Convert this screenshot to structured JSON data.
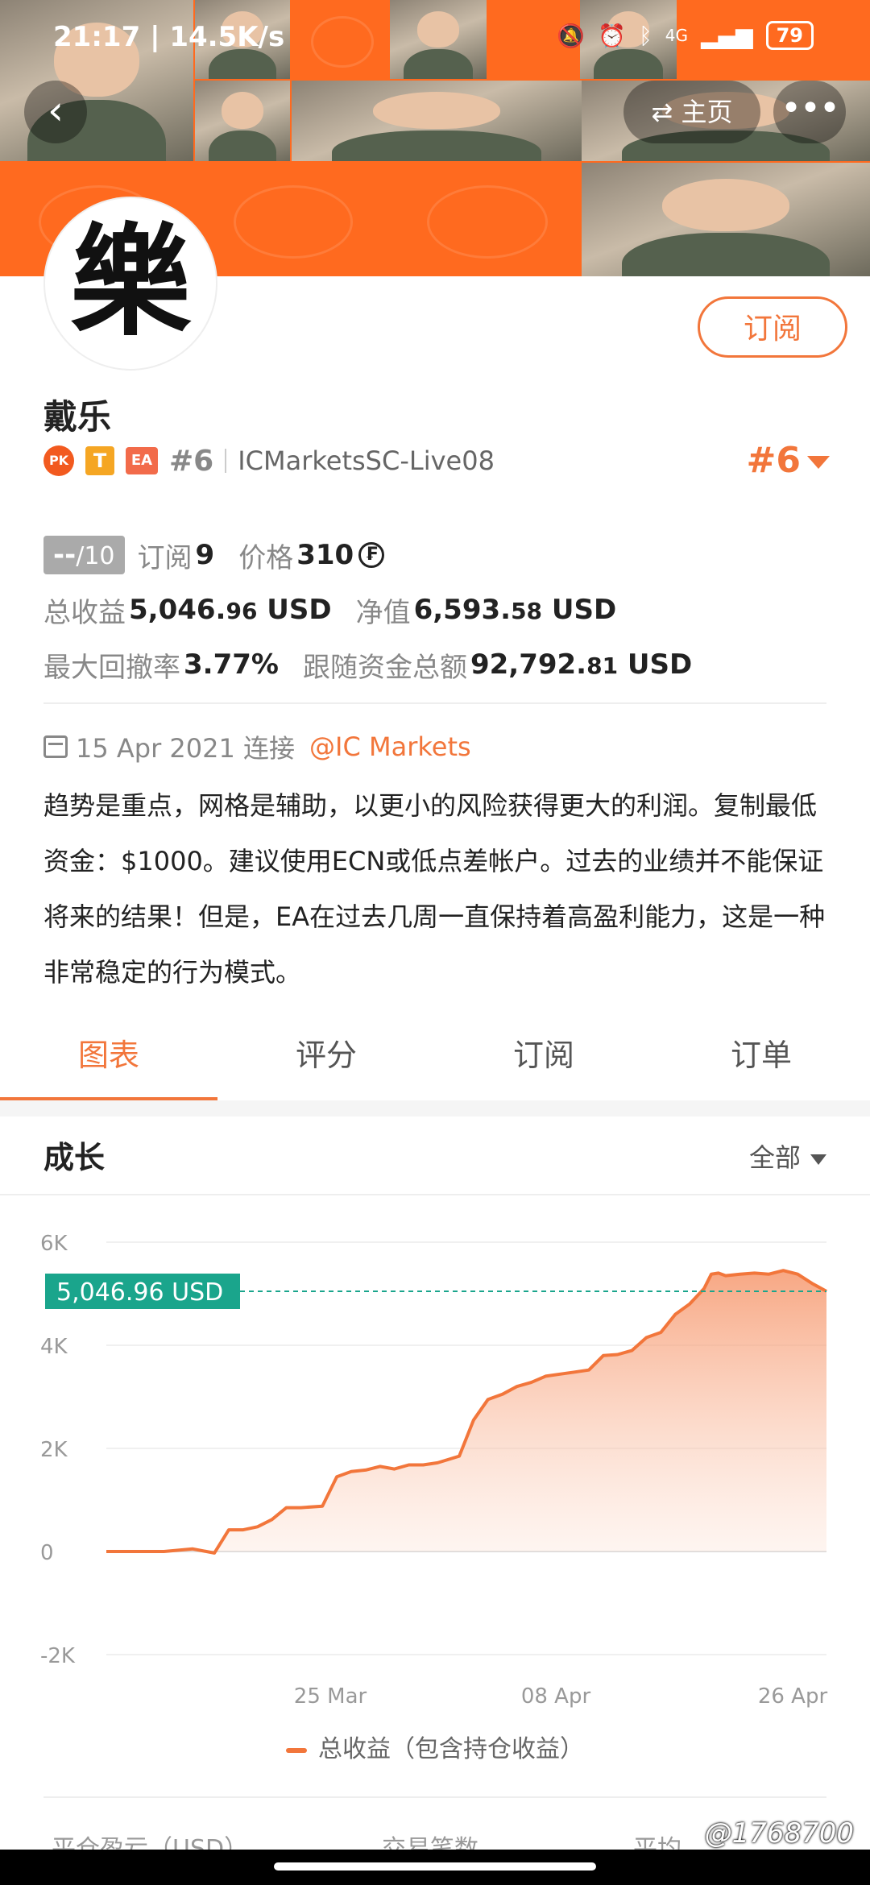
{
  "status_bar": {
    "time": "21:17 | 14.5K/s",
    "network": "4G",
    "battery": "79",
    "icons": [
      "mute-bell-icon",
      "alarm-icon",
      "bluetooth-icon",
      "signal-icon",
      "battery-icon"
    ]
  },
  "nav": {
    "back_icon": "‹",
    "home_label": "主页",
    "home_icon": "⇄",
    "more_icon": "•••"
  },
  "profile": {
    "avatar_glyph": "樂",
    "subscribe_label": "订阅",
    "name": "戴乐",
    "badges": [
      "PK",
      "T",
      "EA"
    ],
    "rank_small": "#6",
    "server": "ICMarketsSC-Live08",
    "rank_big": "#6"
  },
  "stats": {
    "score_prefix": "--",
    "score_suffix": "/10",
    "subscriptions_label": "订阅",
    "subscriptions_value": "9",
    "price_label": "价格",
    "price_value": "310",
    "price_icon": "₣",
    "total_profit_label": "总收益",
    "total_profit_main": "5,046.",
    "total_profit_decimal": "96",
    "total_profit_unit": " USD",
    "equity_label": "净值",
    "equity_main": "6,593.",
    "equity_decimal": "58",
    "equity_unit": " USD",
    "drawdown_label": "最大回撤率",
    "drawdown_value": "3.77%",
    "follow_funds_label": "跟随资金总额",
    "follow_funds_main": "92,792.",
    "follow_funds_decimal": "81",
    "follow_funds_unit": " USD"
  },
  "description": {
    "date": "15 Apr 2021 连接",
    "broker_link": "@IC Markets",
    "text": "趋势是重点，网格是辅助，以更小的风险获得更大的利润。复制最低资金：$1000。建议使用ECN或低点差帐户。过去的业绩并不能保证将来的结果！但是，EA在过去几周一直保持着高盈利能力，这是一种非常稳定的行为模式。"
  },
  "tabs": [
    {
      "label": "图表",
      "active": true
    },
    {
      "label": "评分",
      "active": false
    },
    {
      "label": "订阅",
      "active": false
    },
    {
      "label": "订单",
      "active": false
    }
  ],
  "section": {
    "title": "成长",
    "range_label": "全部"
  },
  "colors": {
    "accent": "#f2763b",
    "callout": "#1aa58c",
    "area_fill": "#f9b79a"
  },
  "chart_data": {
    "type": "area",
    "title": "",
    "xlabel": "",
    "ylabel": "",
    "ylim": [
      -2000,
      6000
    ],
    "yticks": [
      6000,
      4000,
      2000,
      0,
      -2000
    ],
    "ytick_labels": [
      "6K",
      "4K",
      "2K",
      "0",
      "-2K"
    ],
    "xtick_labels": [
      "25 Mar",
      "08 Apr",
      "26 Apr"
    ],
    "current_value_label": "5,046.96 USD",
    "current_value": 5046.96,
    "legend": [
      "总收益（包含持仓收益）"
    ],
    "series": [
      {
        "name": "总收益（包含持仓收益）",
        "x": [
          0,
          4,
          8,
          12,
          15,
          17,
          19,
          21,
          23,
          25,
          27,
          30,
          32,
          34,
          36,
          38,
          40,
          42,
          44,
          46,
          49,
          51,
          53,
          55,
          57,
          59,
          61,
          63,
          65,
          67,
          69,
          71,
          73,
          75,
          77,
          79,
          81,
          83,
          84,
          85,
          86,
          88,
          90,
          92,
          94,
          96,
          98,
          100
        ],
        "values": [
          0,
          0,
          0,
          50,
          -30,
          420,
          420,
          480,
          620,
          850,
          850,
          880,
          1450,
          1550,
          1580,
          1650,
          1600,
          1680,
          1680,
          1720,
          1850,
          2550,
          2950,
          3050,
          3200,
          3280,
          3400,
          3440,
          3480,
          3520,
          3800,
          3820,
          3900,
          4150,
          4250,
          4600,
          4800,
          5100,
          5380,
          5400,
          5350,
          5380,
          5400,
          5380,
          5450,
          5380,
          5200,
          5046.96
        ]
      }
    ]
  },
  "bottom_labels": [
    "平仓盈亏（USD）",
    "交易笔数",
    "平均"
  ],
  "watermark": "@1768700"
}
